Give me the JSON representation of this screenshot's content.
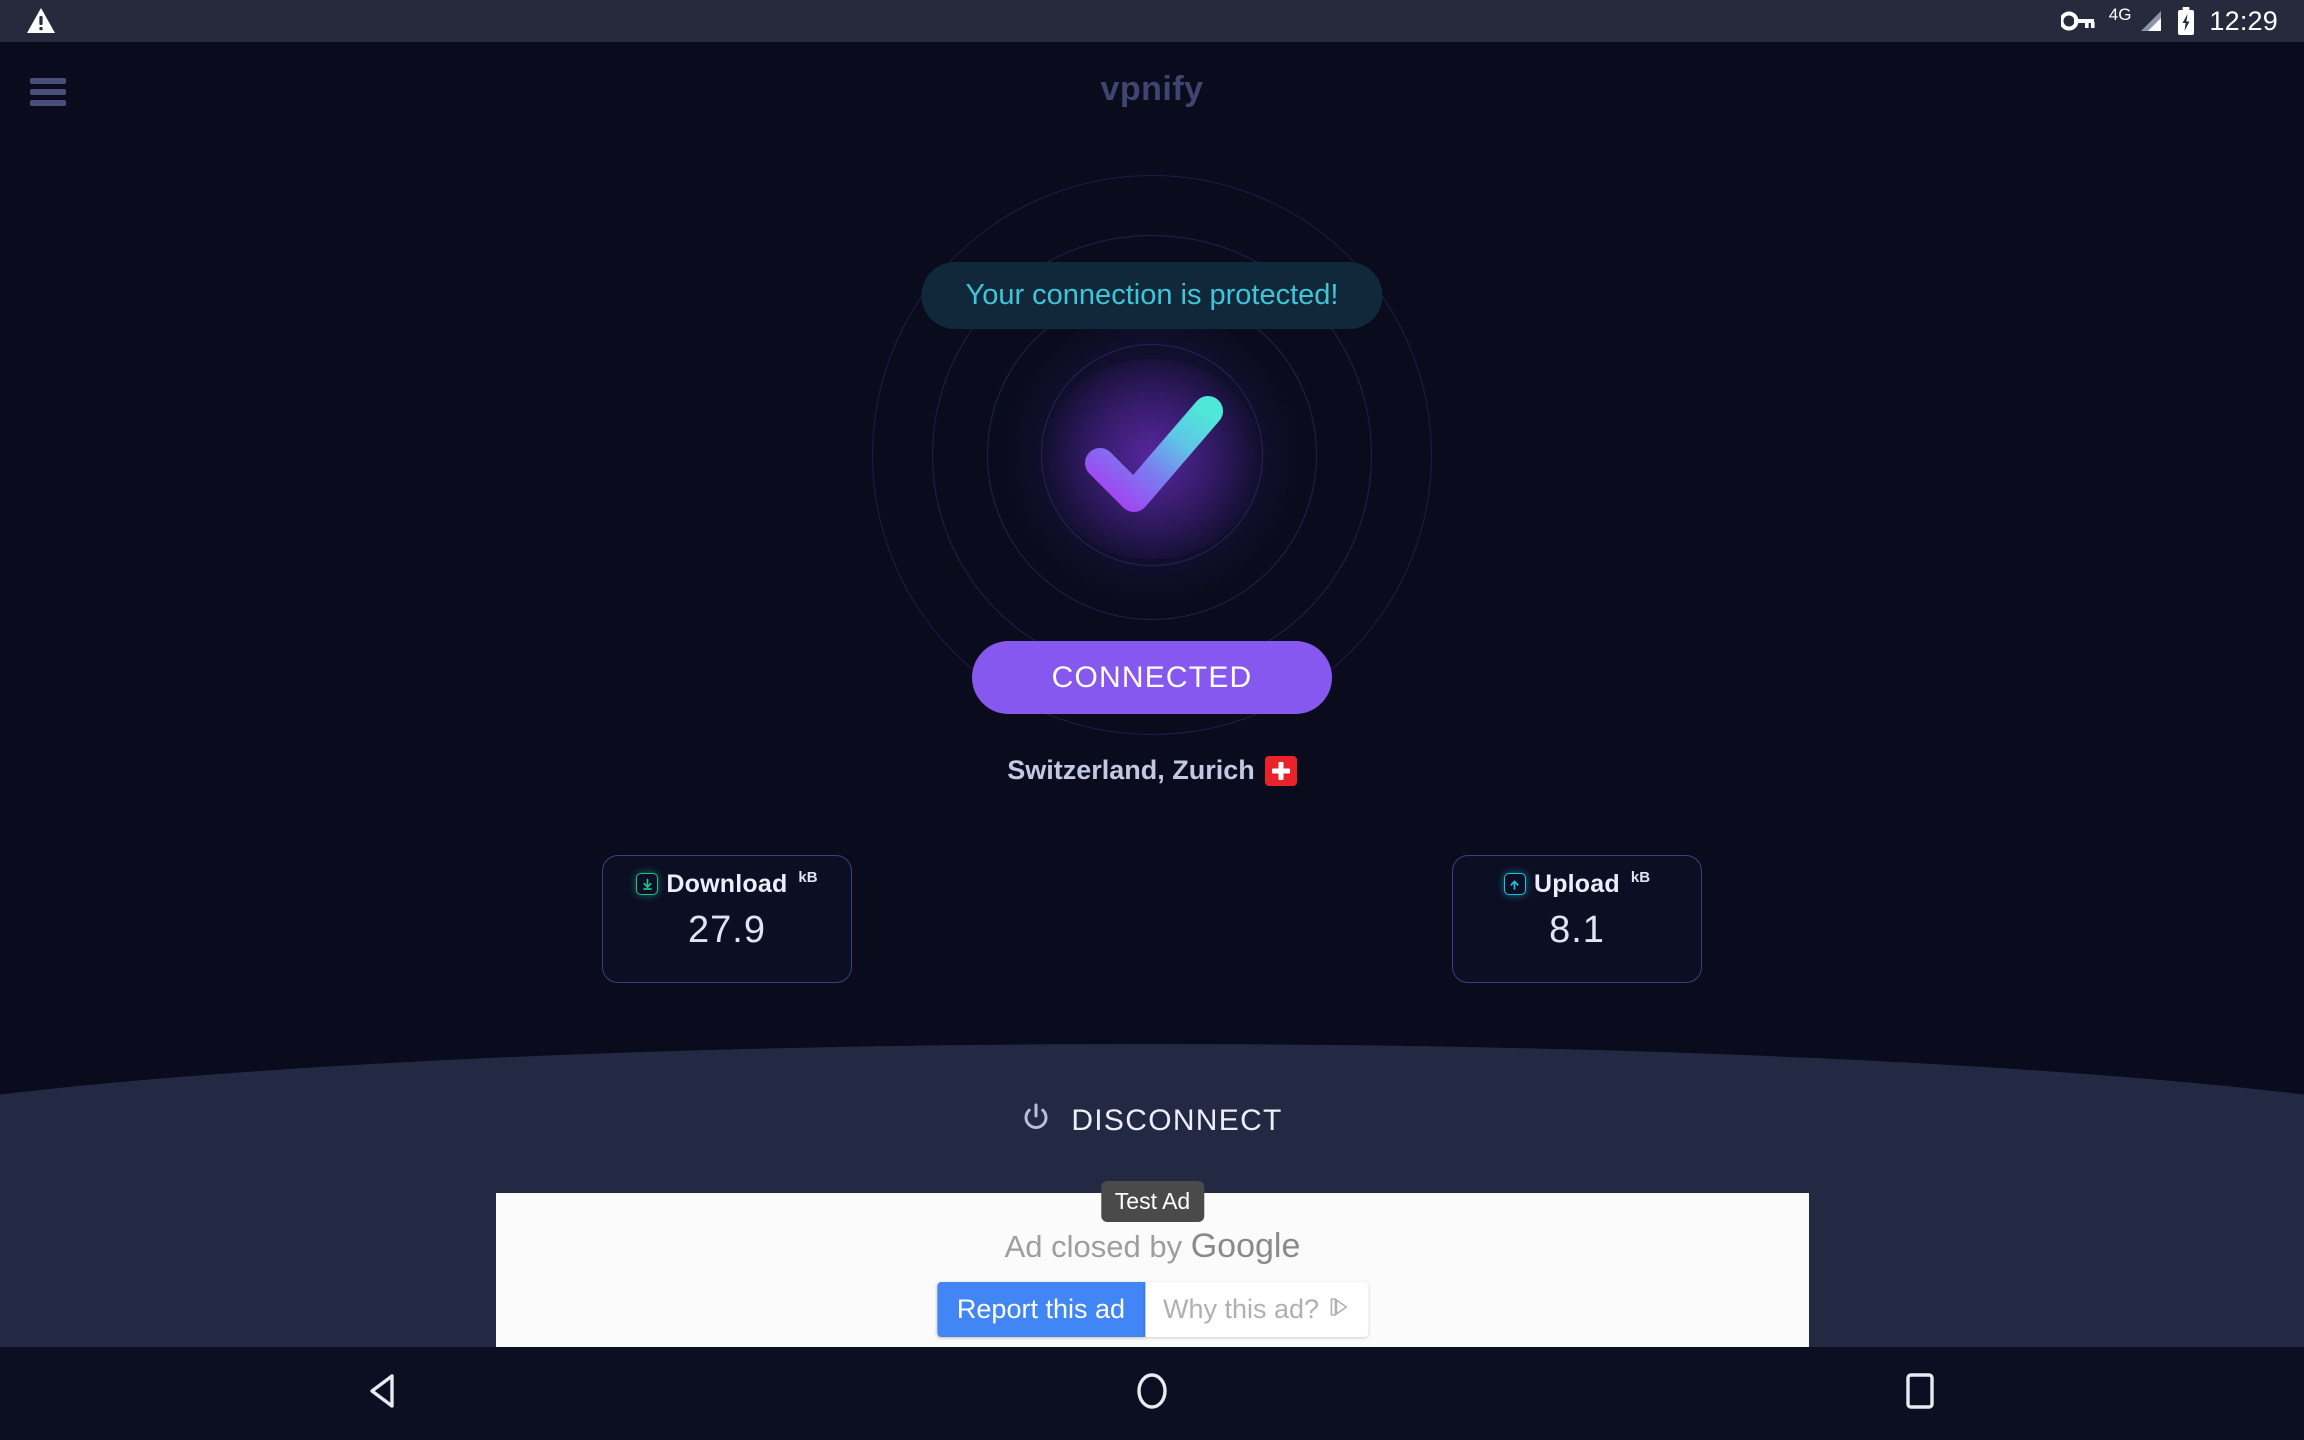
{
  "status_bar": {
    "warning_icon": "warning-triangle-icon",
    "key_icon": "vpn-key-icon",
    "network_label": "4G",
    "signal_icon": "signal-bars-icon",
    "battery_icon": "battery-charging-icon",
    "time": "12:29"
  },
  "header": {
    "menu_icon": "hamburger-menu-icon",
    "title": "vpnify"
  },
  "main": {
    "status_pill": "Your connection is protected!",
    "check_icon": "check-mark-icon",
    "connect_button_label": "CONNECTED",
    "location": "Switzerland, Zurich",
    "flag": "swiss-flag",
    "stats": [
      {
        "icon": "download-arrow-icon",
        "label": "Download",
        "unit": "kB",
        "value": "27.9"
      },
      {
        "icon": "upload-arrow-icon",
        "label": "Upload",
        "unit": "kB",
        "value": "8.1"
      }
    ]
  },
  "bottom_bar": {
    "power_icon": "power-icon",
    "disconnect_label": "DISCONNECT"
  },
  "ad": {
    "test_badge": "Test Ad",
    "closed_text": "Ad closed by ",
    "brand": "Google",
    "report_label": "Report this ad",
    "why_label": "Why this ad?",
    "why_icon": "adchoices-icon"
  },
  "nav_bar": {
    "back": "back-triangle-icon",
    "home": "home-circle-icon",
    "recents": "recents-square-icon"
  },
  "colors": {
    "background": "#0a0c1e",
    "status_bar": "#252a3d",
    "accent_purple": "#8758f0",
    "accent_cyan": "#3fc5d8",
    "card_border": "#3b3f82",
    "bottom_bar": "#242943",
    "download_green": "#1fc08a",
    "upload_cyan": "#1fc0d8",
    "ad_blue": "#4285f4"
  }
}
